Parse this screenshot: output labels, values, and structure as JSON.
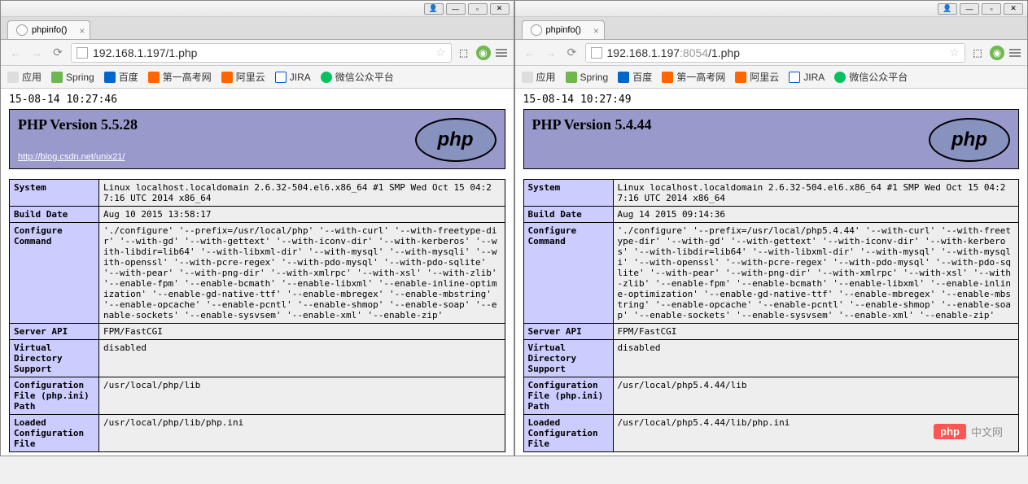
{
  "left": {
    "tab_title": "phpinfo()",
    "url_host": "192.168.1.197",
    "url_port": "",
    "url_path": "/1.php",
    "timestamp": "15-08-14 10:27:46",
    "php_version": "PHP Version 5.5.28",
    "blog_url": "http://blog.csdn.net/unix21/",
    "rows": {
      "system": {
        "k": "System",
        "v": "Linux localhost.localdomain 2.6.32-504.el6.x86_64 #1 SMP Wed Oct 15 04:27:16 UTC 2014 x86_64"
      },
      "build": {
        "k": "Build Date",
        "v": "Aug 10 2015 13:58:17"
      },
      "configure": {
        "k": "Configure Command",
        "v": "'./configure' '--prefix=/usr/local/php' '--with-curl' '--with-freetype-dir' '--with-gd' '--with-gettext' '--with-iconv-dir' '--with-kerberos' '--with-libdir=lib64' '--with-libxml-dir' '--with-mysql' '--with-mysqli' '--with-openssl' '--with-pcre-regex' '--with-pdo-mysql' '--with-pdo-sqlite' '--with-pear' '--with-png-dir' '--with-xmlrpc' '--with-xsl' '--with-zlib' '--enable-fpm' '--enable-bcmath' '--enable-libxml' '--enable-inline-optimization' '--enable-gd-native-ttf' '--enable-mbregex' '--enable-mbstring' '--enable-opcache' '--enable-pcntl' '--enable-shmop' '--enable-soap' '--enable-sockets' '--enable-sysvsem' '--enable-xml' '--enable-zip'"
      },
      "sapi": {
        "k": "Server API",
        "v": "FPM/FastCGI"
      },
      "vds": {
        "k": "Virtual Directory Support",
        "v": "disabled"
      },
      "confpath": {
        "k": "Configuration File (php.ini) Path",
        "v": "/usr/local/php/lib"
      },
      "loaded": {
        "k": "Loaded Configuration File",
        "v": "/usr/local/php/lib/php.ini"
      }
    }
  },
  "right": {
    "tab_title": "phpinfo()",
    "url_host": "192.168.1.197",
    "url_port": ":8054",
    "url_path": "/1.php",
    "timestamp": "15-08-14 10:27:49",
    "php_version": "PHP Version 5.4.44",
    "rows": {
      "system": {
        "k": "System",
        "v": "Linux localhost.localdomain 2.6.32-504.el6.x86_64 #1 SMP Wed Oct 15 04:27:16 UTC 2014 x86_64"
      },
      "build": {
        "k": "Build Date",
        "v": "Aug 14 2015 09:14:36"
      },
      "configure": {
        "k": "Configure Command",
        "v": "'./configure' '--prefix=/usr/local/php5.4.44' '--with-curl' '--with-freetype-dir' '--with-gd' '--with-gettext' '--with-iconv-dir' '--with-kerberos' '--with-libdir=lib64' '--with-libxml-dir' '--with-mysql' '--with-mysqli' '--with-openssl' '--with-pcre-regex' '--with-pdo-mysql' '--with-pdo-sqlite' '--with-pear' '--with-png-dir' '--with-xmlrpc' '--with-xsl' '--with-zlib' '--enable-fpm' '--enable-bcmath' '--enable-libxml' '--enable-inline-optimization' '--enable-gd-native-ttf' '--enable-mbregex' '--enable-mbstring' '--enable-opcache' '--enable-pcntl' '--enable-shmop' '--enable-soap' '--enable-sockets' '--enable-sysvsem' '--enable-xml' '--enable-zip'"
      },
      "sapi": {
        "k": "Server API",
        "v": "FPM/FastCGI"
      },
      "vds": {
        "k": "Virtual Directory Support",
        "v": "disabled"
      },
      "confpath": {
        "k": "Configuration File (php.ini) Path",
        "v": "/usr/local/php5.4.44/lib"
      },
      "loaded": {
        "k": "Loaded Configuration File",
        "v": "/usr/local/php5.4.44/lib/php.ini"
      }
    }
  },
  "bookmarks": {
    "apps": "应用",
    "spring": "Spring",
    "baidu": "百度",
    "gaokao": "第一高考网",
    "aliyun": "阿里云",
    "jira": "JIRA",
    "weixin": "微信公众平台"
  },
  "logo_text": "php",
  "watermark": {
    "logo": "php",
    "text": "中文网"
  }
}
